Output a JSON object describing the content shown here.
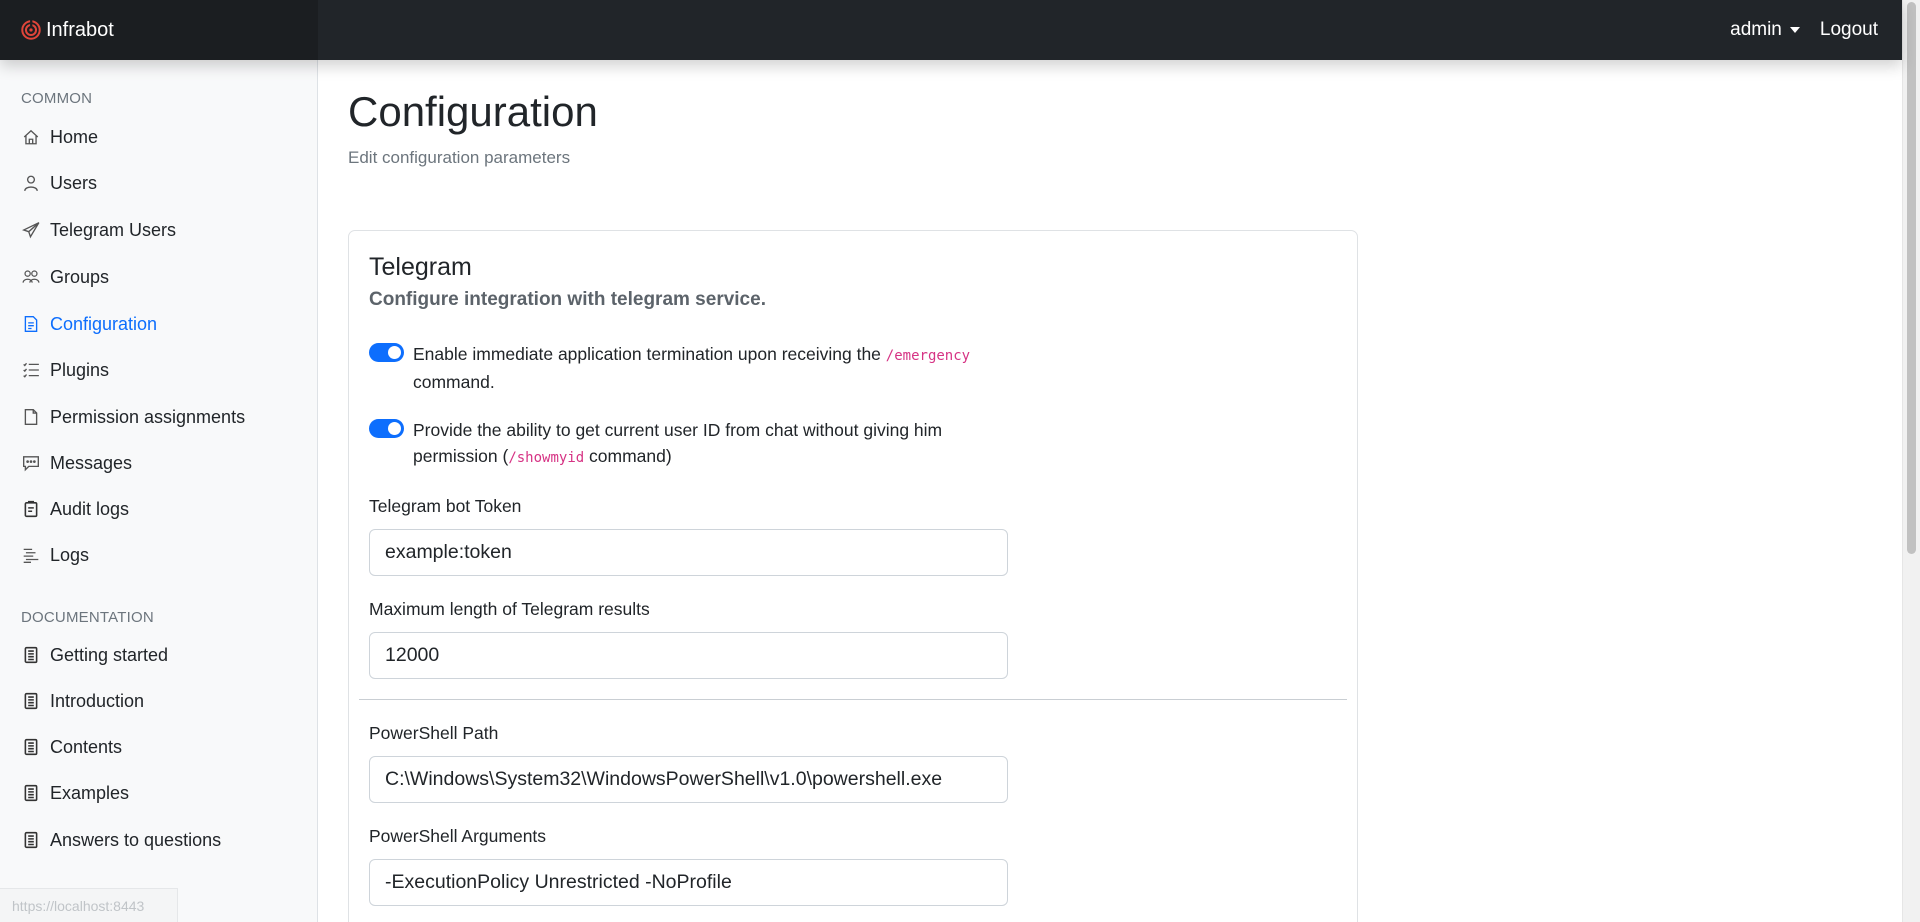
{
  "app": {
    "brand": "Infrabot",
    "user": "admin",
    "logout": "Logout"
  },
  "sidebar": {
    "common_heading": "COMMON",
    "common_items": [
      {
        "label": "Home",
        "icon": "home-icon"
      },
      {
        "label": "Users",
        "icon": "user-icon"
      },
      {
        "label": "Telegram Users",
        "icon": "send-icon"
      },
      {
        "label": "Groups",
        "icon": "people-icon"
      },
      {
        "label": "Configuration",
        "icon": "document-icon",
        "active": true
      },
      {
        "label": "Plugins",
        "icon": "list-check-icon"
      },
      {
        "label": "Permission assignments",
        "icon": "file-icon"
      },
      {
        "label": "Messages",
        "icon": "chat-icon"
      },
      {
        "label": "Audit logs",
        "icon": "clipboard-icon"
      },
      {
        "label": "Logs",
        "icon": "text-lines-icon"
      }
    ],
    "doc_heading": "DOCUMENTATION",
    "doc_items": [
      {
        "label": "Getting started",
        "icon": "book-icon"
      },
      {
        "label": "Introduction",
        "icon": "book-icon"
      },
      {
        "label": "Contents",
        "icon": "book-icon"
      },
      {
        "label": "Examples",
        "icon": "book-icon"
      },
      {
        "label": "Answers to questions",
        "icon": "book-icon"
      }
    ],
    "status_url": "https://localhost:8443"
  },
  "page": {
    "title": "Configuration",
    "subtitle": "Edit configuration parameters"
  },
  "telegram": {
    "title": "Telegram",
    "subtitle": "Configure integration with telegram service.",
    "emergency_toggle": {
      "checked": true,
      "text_before": "Enable immediate application termination upon receiving the ",
      "code": "/emergency",
      "text_after": " command."
    },
    "showmyid_toggle": {
      "checked": true,
      "text_before": "Provide the ability to get current user ID from chat without giving him permission (",
      "code": "/showmyid",
      "text_after": " command)"
    },
    "bot_token": {
      "label": "Telegram bot Token",
      "value": "example:token"
    },
    "max_length": {
      "label": "Maximum length of Telegram results",
      "value": "12000"
    }
  },
  "powershell": {
    "path": {
      "label": "PowerShell Path",
      "value": "C:\\Windows\\System32\\WindowsPowerShell\\v1.0\\powershell.exe"
    },
    "arguments": {
      "label": "PowerShell Arguments",
      "value": "-ExecutionPolicy Unrestricted -NoProfile"
    }
  },
  "colors": {
    "navbar": "#212529",
    "accent": "#0d6efd",
    "code": "#d63384"
  }
}
